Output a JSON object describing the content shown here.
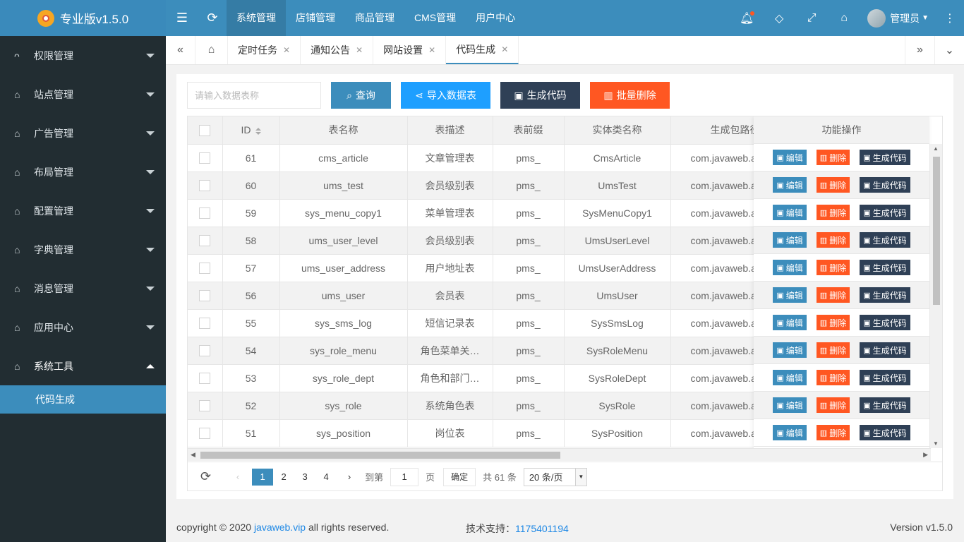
{
  "app": {
    "brand": "专业版v1.5.0"
  },
  "topnav": [
    {
      "label": "系统管理",
      "active": true
    },
    {
      "label": "店铺管理"
    },
    {
      "label": "商品管理"
    },
    {
      "label": "CMS管理"
    },
    {
      "label": "用户中心"
    }
  ],
  "user": {
    "name": "管理员"
  },
  "sidebar": {
    "items": [
      {
        "label": "权限管理",
        "icon": "user-icon"
      },
      {
        "label": "站点管理",
        "icon": "home-icon"
      },
      {
        "label": "广告管理",
        "icon": "home-icon"
      },
      {
        "label": "布局管理",
        "icon": "home-icon"
      },
      {
        "label": "配置管理",
        "icon": "home-icon"
      },
      {
        "label": "字典管理",
        "icon": "home-icon"
      },
      {
        "label": "消息管理",
        "icon": "home-icon"
      },
      {
        "label": "应用中心",
        "icon": "home-icon"
      },
      {
        "label": "系统工具",
        "icon": "home-icon",
        "open": true
      }
    ],
    "sub": "代码生成"
  },
  "tabs": [
    {
      "label": "定时任务"
    },
    {
      "label": "通知公告"
    },
    {
      "label": "网站设置"
    },
    {
      "label": "代码生成",
      "active": true
    }
  ],
  "toolbar": {
    "search_placeholder": "请输入数据表称",
    "query": "查询",
    "import": "导入数据表",
    "generate": "生成代码",
    "batch_delete": "批量删除"
  },
  "colors": {
    "primary": "#3c8dbc",
    "blue": "#1e9fff",
    "dark": "#2f4056",
    "orange": "#ff5722",
    "sidebar": "#222d32"
  },
  "table": {
    "headers": {
      "id": "ID",
      "name": "表名称",
      "desc": "表描述",
      "prefix": "表前缀",
      "entity": "实体类名称",
      "pkg": "生成包路径",
      "ops": "功能操作"
    },
    "ops": {
      "edit": "编辑",
      "delete": "删除",
      "gen": "生成代码"
    },
    "rows": [
      {
        "id": "61",
        "name": "cms_article",
        "desc": "文章管理表",
        "prefix": "pms_",
        "entity": "CmsArticle",
        "pkg": "com.javaweb.a"
      },
      {
        "id": "60",
        "name": "ums_test",
        "desc": "会员级别表",
        "prefix": "pms_",
        "entity": "UmsTest",
        "pkg": "com.javaweb.a"
      },
      {
        "id": "59",
        "name": "sys_menu_copy1",
        "desc": "菜单管理表",
        "prefix": "pms_",
        "entity": "SysMenuCopy1",
        "pkg": "com.javaweb.a"
      },
      {
        "id": "58",
        "name": "ums_user_level",
        "desc": "会员级别表",
        "prefix": "pms_",
        "entity": "UmsUserLevel",
        "pkg": "com.javaweb.a"
      },
      {
        "id": "57",
        "name": "ums_user_address",
        "desc": "用户地址表",
        "prefix": "pms_",
        "entity": "UmsUserAddress",
        "pkg": "com.javaweb.a"
      },
      {
        "id": "56",
        "name": "ums_user",
        "desc": "会员表",
        "prefix": "pms_",
        "entity": "UmsUser",
        "pkg": "com.javaweb.a"
      },
      {
        "id": "55",
        "name": "sys_sms_log",
        "desc": "短信记录表",
        "prefix": "pms_",
        "entity": "SysSmsLog",
        "pkg": "com.javaweb.a"
      },
      {
        "id": "54",
        "name": "sys_role_menu",
        "desc": "角色菜单关…",
        "prefix": "pms_",
        "entity": "SysRoleMenu",
        "pkg": "com.javaweb.a"
      },
      {
        "id": "53",
        "name": "sys_role_dept",
        "desc": "角色和部门…",
        "prefix": "pms_",
        "entity": "SysRoleDept",
        "pkg": "com.javaweb.a"
      },
      {
        "id": "52",
        "name": "sys_role",
        "desc": "系统角色表",
        "prefix": "pms_",
        "entity": "SysRole",
        "pkg": "com.javaweb.a"
      },
      {
        "id": "51",
        "name": "sys_position",
        "desc": "岗位表",
        "prefix": "pms_",
        "entity": "SysPosition",
        "pkg": "com.javaweb.a"
      }
    ]
  },
  "pager": {
    "pages": [
      "1",
      "2",
      "3",
      "4"
    ],
    "goto": "到第",
    "page_value": "1",
    "page_unit": "页",
    "confirm": "确定",
    "total": "共 61 条",
    "size": "20 条/页"
  },
  "footer": {
    "copyright_prefix": "copyright © 2020 ",
    "link": "javaweb.vip",
    "copyright_suffix": " all rights reserved.",
    "support_label": "技术支持：",
    "support_value": "1175401194",
    "version": "Version v1.5.0"
  }
}
